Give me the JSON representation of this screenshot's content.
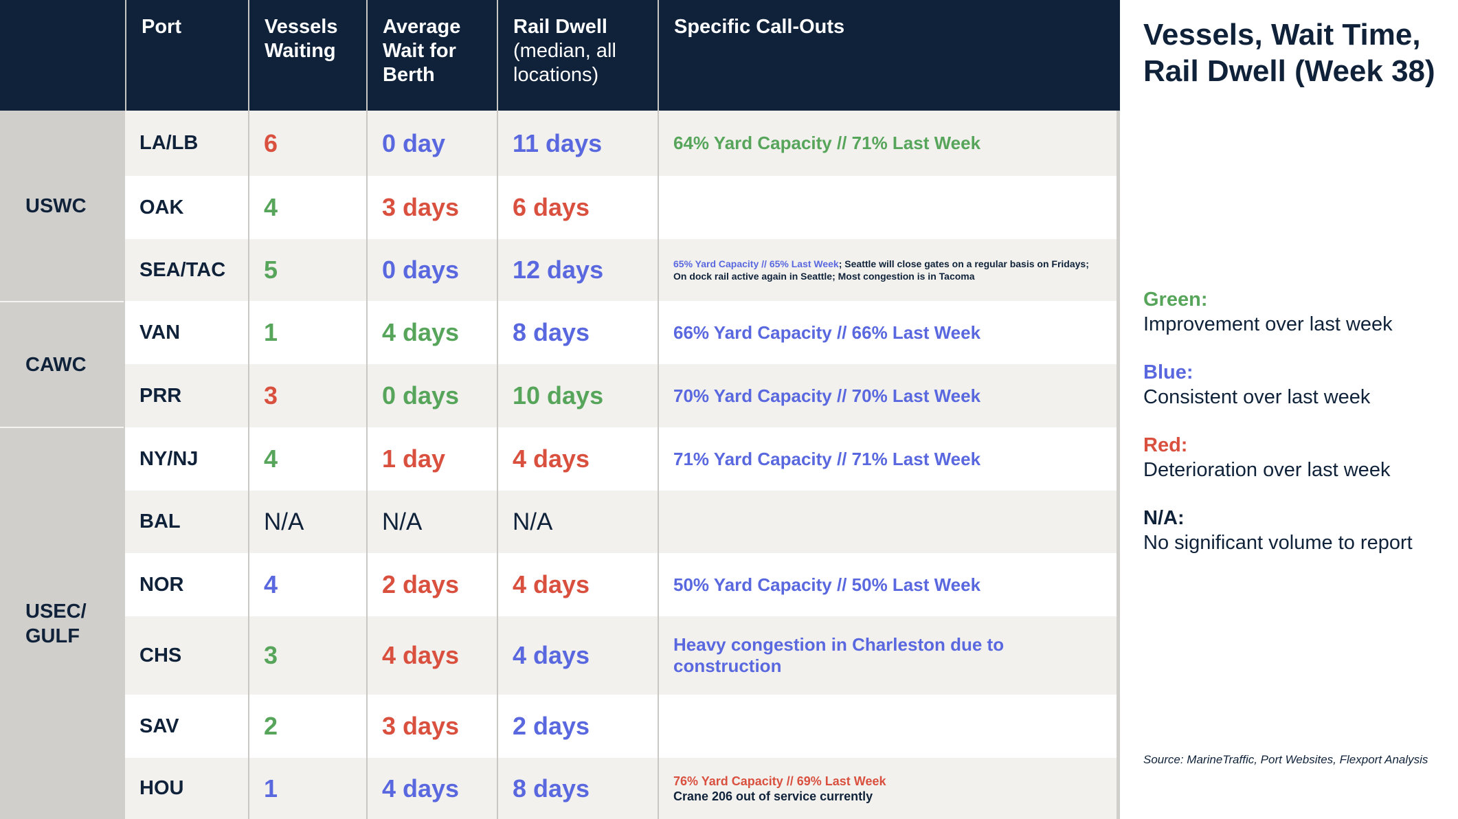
{
  "colors": {
    "navy": "#0F2239",
    "green": "#57A55A",
    "blue": "#5A68DF",
    "red": "#D9503F",
    "row_alt": "#F2F1EE",
    "region_bg": "#D0CFCC"
  },
  "header": {
    "port": "Port",
    "vessels_waiting": [
      "Vessels",
      "Waiting"
    ],
    "avg_wait": [
      "Average",
      "Wait for",
      "Berth"
    ],
    "rail_dwell_title": "Rail Dwell",
    "rail_dwell_sub": [
      "(median, all",
      "locations)"
    ],
    "callouts": "Specific Call-Outs"
  },
  "regions": [
    {
      "label": "USWC"
    },
    {
      "label": "CAWC"
    },
    {
      "label": "USEC/\nGULF"
    }
  ],
  "rows": [
    {
      "port": "LA/LB",
      "vessels": {
        "text": "6",
        "status": "red"
      },
      "wait": {
        "text": "0 day",
        "status": "blue"
      },
      "rail": {
        "text": "11 days",
        "status": "blue"
      },
      "callout": [
        {
          "text": "64% Yard Capacity // 71% Last Week",
          "status": "green"
        }
      ]
    },
    {
      "port": "OAK",
      "vessels": {
        "text": "4",
        "status": "green"
      },
      "wait": {
        "text": "3 days",
        "status": "red"
      },
      "rail": {
        "text": "6 days",
        "status": "red"
      },
      "callout": []
    },
    {
      "port": "SEA/TAC",
      "vessels": {
        "text": "5",
        "status": "green"
      },
      "wait": {
        "text": "0 days",
        "status": "blue"
      },
      "rail": {
        "text": "12 days",
        "status": "blue"
      },
      "callout": [
        {
          "text": "65% Yard Capacity // 65% Last Week",
          "status": "blue"
        },
        {
          "text": "; Seattle will close gates on a regular basis on Fridays; On dock rail active again in Seattle; Most congestion is in Tacoma",
          "status": "navy"
        }
      ]
    },
    {
      "port": "VAN",
      "vessels": {
        "text": "1",
        "status": "green"
      },
      "wait": {
        "text": "4 days",
        "status": "green"
      },
      "rail": {
        "text": "8 days",
        "status": "blue"
      },
      "callout": [
        {
          "text": "66% Yard Capacity // 66% Last Week",
          "status": "blue"
        }
      ]
    },
    {
      "port": "PRR",
      "vessels": {
        "text": "3",
        "status": "red"
      },
      "wait": {
        "text": "0 days",
        "status": "green"
      },
      "rail": {
        "text": "10 days",
        "status": "green"
      },
      "callout": [
        {
          "text": "70% Yard Capacity // 70% Last Week",
          "status": "blue"
        }
      ]
    },
    {
      "port": "NY/NJ",
      "vessels": {
        "text": "4",
        "status": "green"
      },
      "wait": {
        "text": "1 day",
        "status": "red"
      },
      "rail": {
        "text": "4 days",
        "status": "red"
      },
      "callout": [
        {
          "text": "71% Yard Capacity // 71% Last Week",
          "status": "blue"
        }
      ]
    },
    {
      "port": "BAL",
      "vessels": {
        "text": "N/A",
        "status": "na"
      },
      "wait": {
        "text": "N/A",
        "status": "na"
      },
      "rail": {
        "text": "N/A",
        "status": "na"
      },
      "callout": []
    },
    {
      "port": "NOR",
      "vessels": {
        "text": "4",
        "status": "blue"
      },
      "wait": {
        "text": "2 days",
        "status": "red"
      },
      "rail": {
        "text": "4 days",
        "status": "red"
      },
      "callout": [
        {
          "text": "50% Yard Capacity // 50% Last Week",
          "status": "blue"
        }
      ]
    },
    {
      "port": "CHS",
      "vessels": {
        "text": "3",
        "status": "green"
      },
      "wait": {
        "text": "4 days",
        "status": "red"
      },
      "rail": {
        "text": "4 days",
        "status": "blue"
      },
      "callout": [
        {
          "text": "Heavy congestion in Charleston due to construction",
          "status": "blue"
        }
      ]
    },
    {
      "port": "SAV",
      "vessels": {
        "text": "2",
        "status": "green"
      },
      "wait": {
        "text": "3 days",
        "status": "red"
      },
      "rail": {
        "text": "2 days",
        "status": "blue"
      },
      "callout": []
    },
    {
      "port": "HOU",
      "vessels": {
        "text": "1",
        "status": "blue"
      },
      "wait": {
        "text": "4 days",
        "status": "blue"
      },
      "rail": {
        "text": "8 days",
        "status": "blue"
      },
      "callout": [
        {
          "text": "76% Yard Capacity // 69% Last Week",
          "status": "red",
          "block": true
        },
        {
          "text": "Crane 206 out of service currently",
          "status": "navy",
          "block": true
        }
      ]
    }
  ],
  "side": {
    "title": "Vessels, Wait Time, Rail Dwell (Week 38)",
    "legend": [
      {
        "key": "Green:",
        "desc": "Improvement over last week",
        "status": "green"
      },
      {
        "key": "Blue:",
        "desc": "Consistent over last week",
        "status": "blue"
      },
      {
        "key": "Red:",
        "desc": "Deterioration over last week",
        "status": "red"
      },
      {
        "key": "N/A:",
        "desc": "No significant volume to report",
        "status": "navy"
      }
    ],
    "source": "Source: MarineTraffic, Port Websites, Flexport Analysis"
  }
}
